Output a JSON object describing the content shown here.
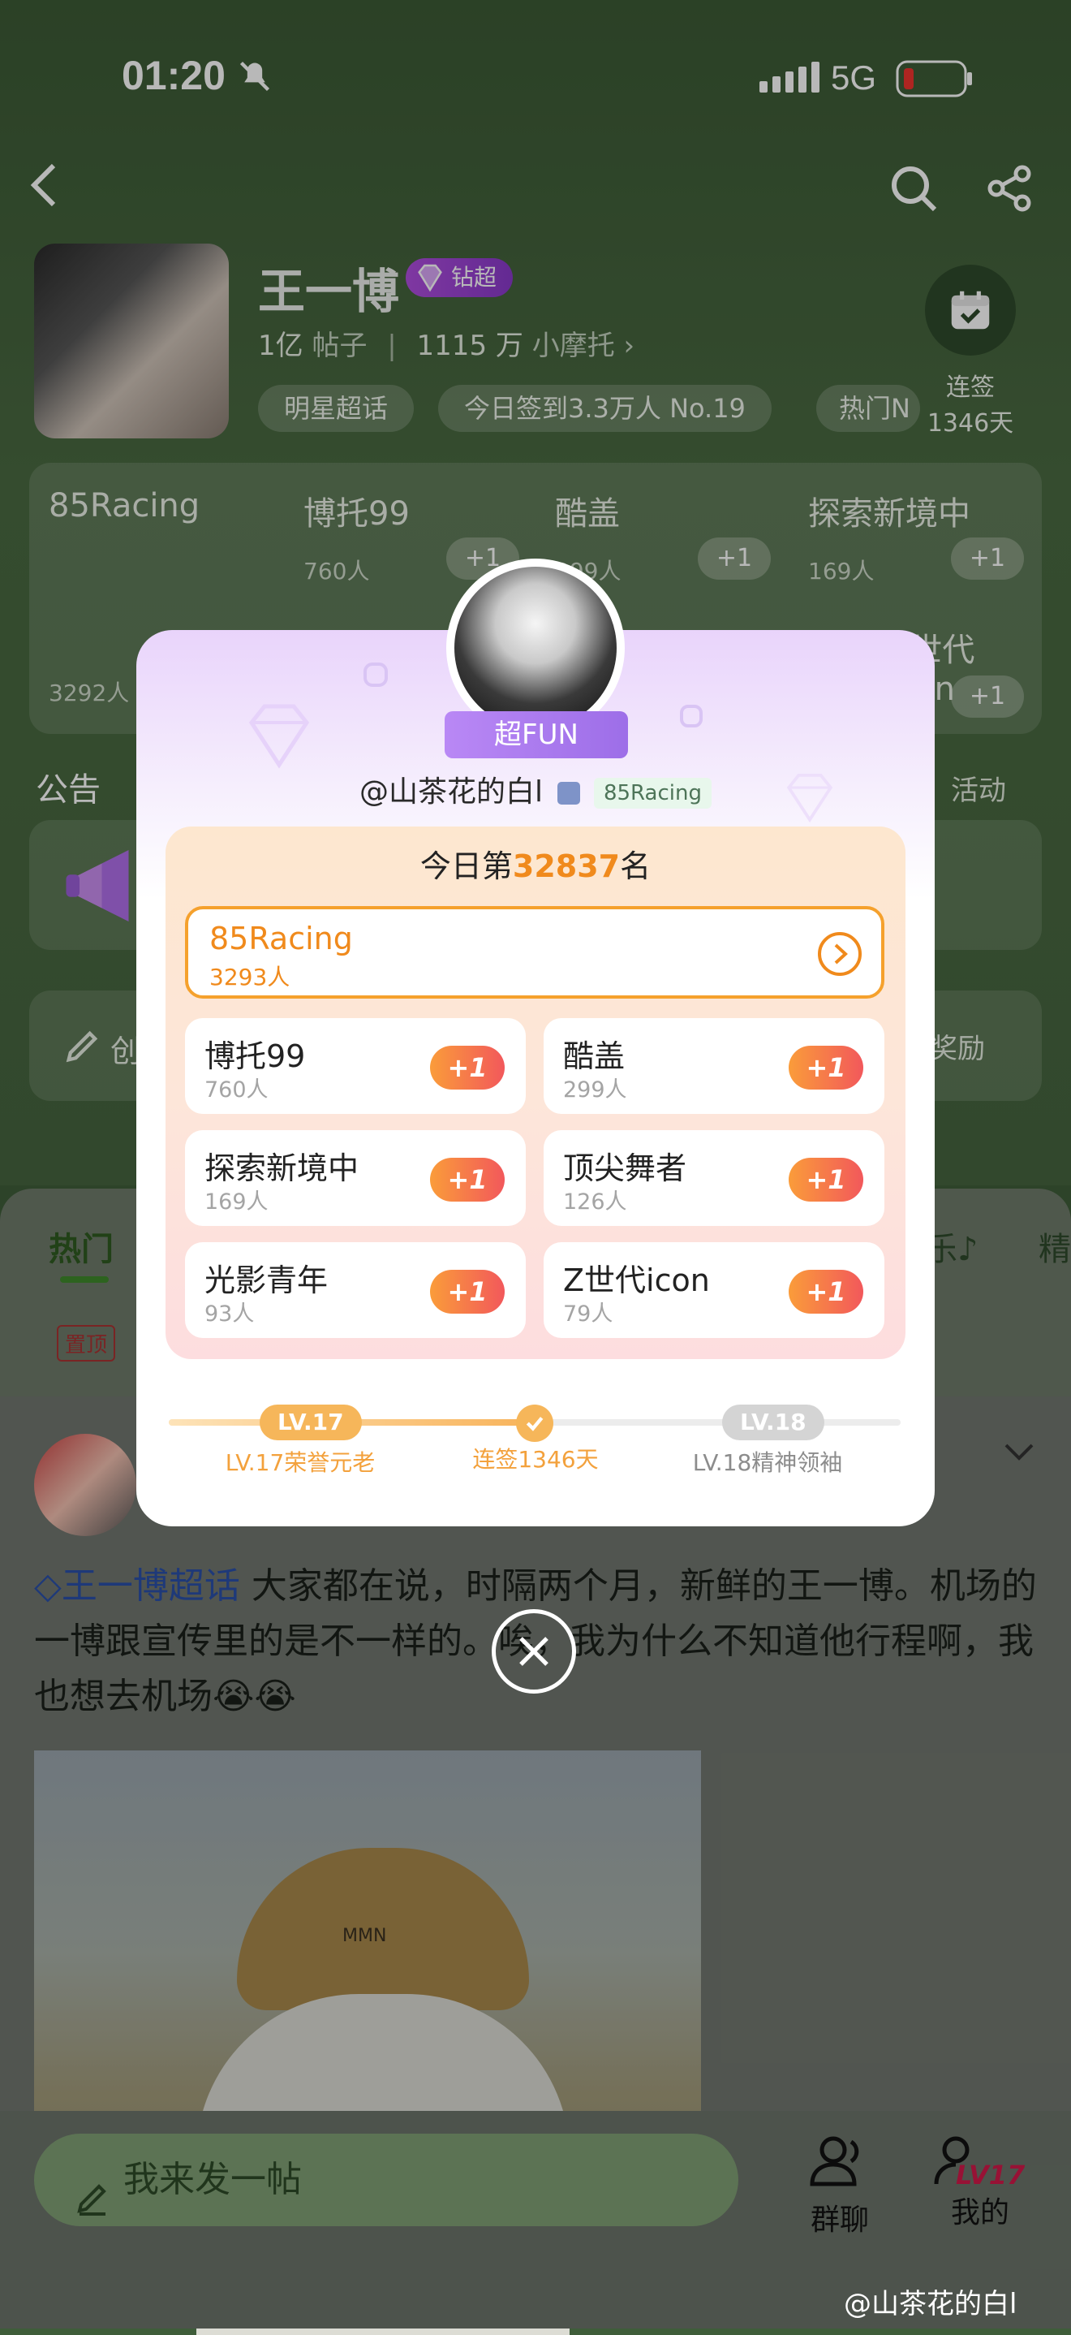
{
  "status_bar": {
    "time": "01:20",
    "network": "5G"
  },
  "profile": {
    "name": "王一博",
    "badge": "钻超",
    "posts_count": "1亿",
    "posts_label": "帖子",
    "fans_count": "1115 万",
    "fans_label": "小摩托",
    "chips": [
      "明星超话",
      "今日签到3.3万人 No.19",
      "热门N"
    ],
    "checkin_label": "连签",
    "checkin_days": "1346天"
  },
  "groups_bg": [
    {
      "name": "85Racing",
      "count": "3292人"
    },
    {
      "name": "博托99",
      "count": "760人"
    },
    {
      "name": "酷盖",
      "count": "299人"
    },
    {
      "name": "探索新境中",
      "count": "169人"
    },
    {
      "name": "Z世代icon",
      "count": ""
    }
  ],
  "notice": {
    "label": "公告",
    "activity": "活动",
    "reward": "奖励",
    "create": "创"
  },
  "tabs": {
    "hot": "热门",
    "music": "乐♪",
    "fine": "精",
    "pinned": "置顶"
  },
  "post": {
    "topic": "王一博超话",
    "text": "大家都在说，时隔两个月，新鲜的王一博。机场的一博跟宣传里的是不一样的。唉，我为什么不知道他行程啊，我也想去机场😭😭",
    "hat_text": "MMN"
  },
  "bottom": {
    "compose_placeholder": "我来发一帖",
    "group_chat": "群聊",
    "mine": "我的",
    "level": "LV17"
  },
  "modal": {
    "ribbon": "超FUN",
    "username": "@山茶花的白l",
    "user_tag": "85Racing",
    "rank_prefix": "今日第",
    "rank_number": "32837",
    "rank_suffix": "名",
    "main_group": {
      "name": "85Racing",
      "count": "3293人"
    },
    "groups": [
      {
        "name": "博托99",
        "count": "760人"
      },
      {
        "name": "酷盖",
        "count": "299人"
      },
      {
        "name": "探索新境中",
        "count": "169人"
      },
      {
        "name": "顶尖舞者",
        "count": "126人"
      },
      {
        "name": "光影青年",
        "count": "93人"
      },
      {
        "name": "Z世代icon",
        "count": "79人"
      }
    ],
    "plus_label": "+1",
    "level_current": "LV.17",
    "level_current_label": "LV.17荣誉元老",
    "level_middle_label": "连签1346天",
    "level_next": "LV.18",
    "level_next_label": "LV.18精神领袖"
  },
  "watermark": "@山茶花的白l"
}
